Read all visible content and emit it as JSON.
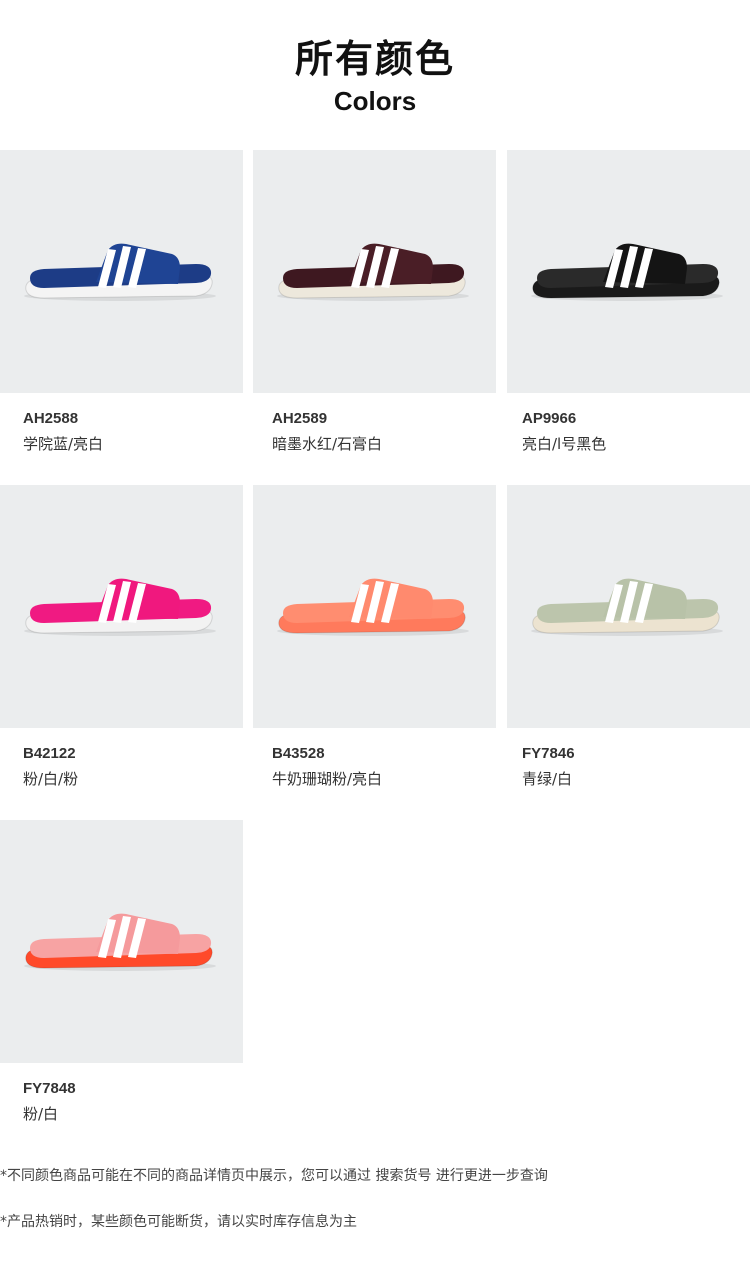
{
  "header": {
    "title_cn": "所有颜色",
    "title_en": "Colors"
  },
  "products": [
    {
      "code": "AH2588",
      "color_name": "学院蓝/亮白",
      "upper_color": "#1f4494",
      "sole_color": "#f4f4f4",
      "footbed_color": "#1d3c86",
      "stripe_color": "#ffffff"
    },
    {
      "code": "AH2589",
      "color_name": "暗墨水红/石膏白",
      "upper_color": "#4a1e26",
      "sole_color": "#ede8dc",
      "footbed_color": "#3e1820",
      "stripe_color": "#ffffff"
    },
    {
      "code": "AP9966",
      "color_name": "亮白/l号黑色",
      "upper_color": "#141414",
      "sole_color": "#1a1a1a",
      "footbed_color": "#2a2a2a",
      "stripe_color": "#ffffff"
    },
    {
      "code": "B42122",
      "color_name": "粉/白/粉",
      "upper_color": "#f0187e",
      "sole_color": "#f2f2f2",
      "footbed_color": "#f01a82",
      "stripe_color": "#ffffff"
    },
    {
      "code": "B43528",
      "color_name": "牛奶珊瑚粉/亮白",
      "upper_color": "#ff8a6e",
      "sole_color": "#ff7a5c",
      "footbed_color": "#ff8d70",
      "stripe_color": "#ffffff"
    },
    {
      "code": "FY7846",
      "color_name": "青绿/白",
      "upper_color": "#b8c2a8",
      "sole_color": "#ece3d0",
      "footbed_color": "#bcc5ac",
      "stripe_color": "#ffffff"
    },
    {
      "code": "FY7848",
      "color_name": "粉/白",
      "upper_color": "#f59a9c",
      "sole_color": "#ff4a2a",
      "footbed_color": "#f7a3a3",
      "stripe_color": "#ffffff"
    }
  ],
  "notes": [
    "*不同颜色商品可能在不同的商品详情页中展示，您可以通过 搜索货号 进行更进一步查询",
    "*产品热销时，某些颜色可能断货，请以实时库存信息为主"
  ]
}
